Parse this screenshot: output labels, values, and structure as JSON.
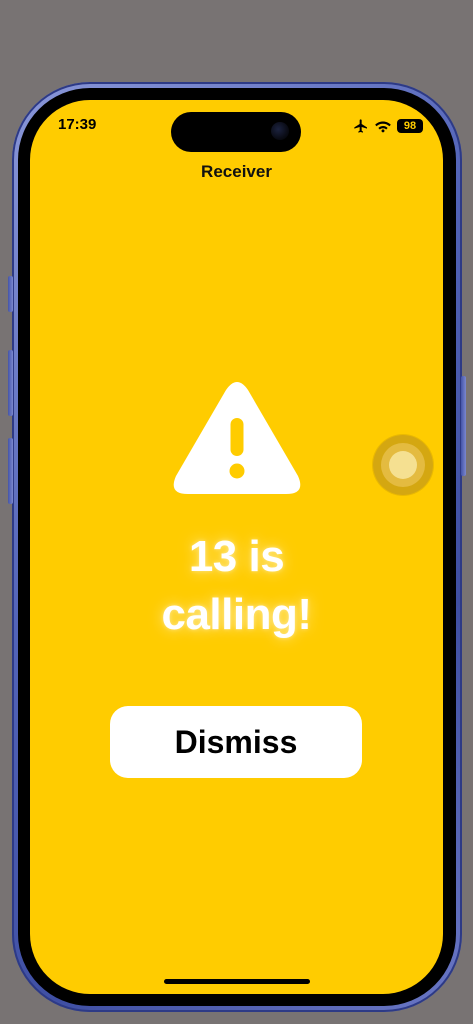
{
  "status_bar": {
    "time": "17:39",
    "battery": "98",
    "icons": [
      "airplane-icon",
      "wifi-icon",
      "battery-icon"
    ]
  },
  "nav": {
    "title": "Receiver"
  },
  "alert": {
    "icon": "warning-triangle-icon",
    "line1": "13 is",
    "line2": "calling!"
  },
  "dismiss_button": {
    "label": "Dismiss"
  },
  "colors": {
    "background": "#FFCC00",
    "text": "#FFFFFF",
    "button_bg": "#FFFFFF",
    "button_text": "#000000",
    "device_frame": "#5364B8",
    "page_bg": "#787373"
  }
}
